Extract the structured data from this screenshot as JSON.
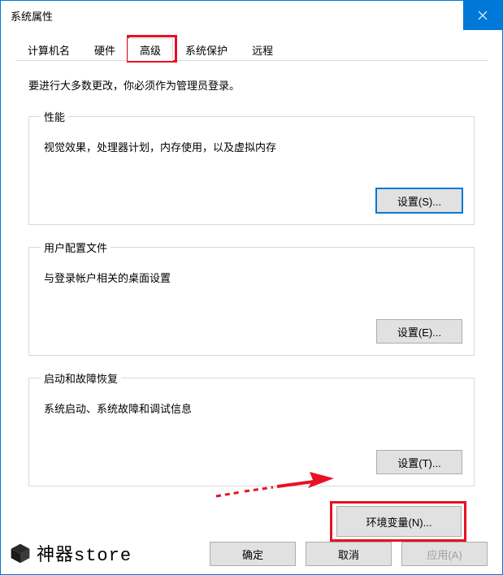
{
  "window": {
    "title": "系统属性"
  },
  "tabs": {
    "items": [
      {
        "label": "计算机名"
      },
      {
        "label": "硬件"
      },
      {
        "label": "高级"
      },
      {
        "label": "系统保护"
      },
      {
        "label": "远程"
      }
    ],
    "active_index": 2
  },
  "intro": "要进行大多数更改，你必须作为管理员登录。",
  "groups": {
    "performance": {
      "legend": "性能",
      "desc": "视觉效果，处理器计划，内存使用，以及虚拟内存",
      "button": "设置(S)..."
    },
    "profiles": {
      "legend": "用户配置文件",
      "desc": "与登录帐户相关的桌面设置",
      "button": "设置(E)..."
    },
    "startup": {
      "legend": "启动和故障恢复",
      "desc": "系统启动、系统故障和调试信息",
      "button": "设置(T)..."
    }
  },
  "env_button": "环境变量(N)...",
  "bottom": {
    "ok": "确定",
    "cancel": "取消",
    "apply": "应用(A)"
  },
  "watermark": {
    "text_cn": "神器",
    "text_en": "store"
  },
  "annotations": {
    "highlight_color": "#e81123"
  }
}
